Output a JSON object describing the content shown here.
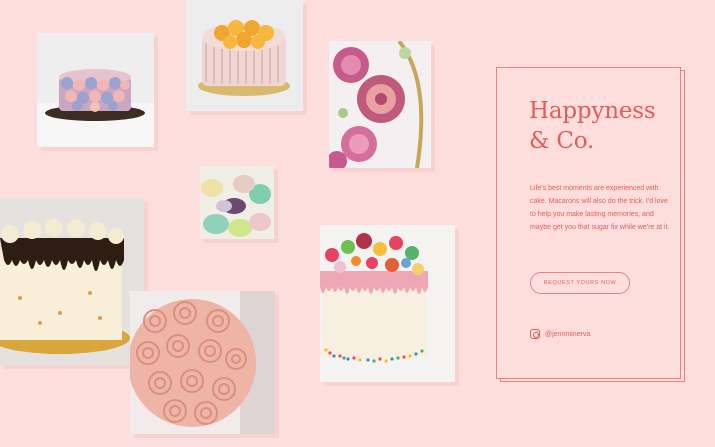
{
  "brand": {
    "title_line1": "Happyness",
    "title_line2": "& Co."
  },
  "card": {
    "blurb": "Life's best moments are experienced with cake. Macarons will also do the trick. I'd love to help you make lasting memories, and maybe get you that sugar fix while we're at it.",
    "cta_label": "REQUEST YOURS NOW",
    "instagram_handle": "@jennminerva"
  },
  "gallery": {
    "photos": [
      {
        "name": "rosette-layer-cake",
        "alt": "Pink and lavender rosette cake"
      },
      {
        "name": "orange-slice-cake",
        "alt": "Pink cake topped with orange slices"
      },
      {
        "name": "peony-cake",
        "alt": "Cake with pink buttercream peonies"
      },
      {
        "name": "macarons",
        "alt": "Pastel macarons"
      },
      {
        "name": "chocolate-drip-cake",
        "alt": "Chocolate drip cake with cream swirls"
      },
      {
        "name": "pink-swirl-cake",
        "alt": "Pink buttercream swirl cake"
      },
      {
        "name": "sprinkle-drip-cake",
        "alt": "Funfetti cake with colorful drip and sprinkles"
      }
    ]
  },
  "colors": {
    "background": "#fddedd",
    "accent": "#e05e5a",
    "border": "#e6837f"
  },
  "icons": {
    "instagram": "instagram-icon"
  }
}
